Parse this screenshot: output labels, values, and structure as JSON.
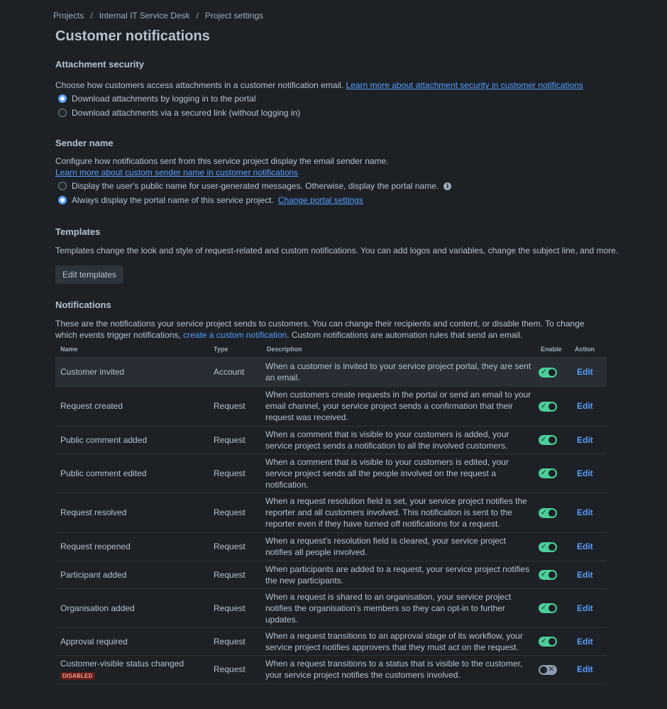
{
  "breadcrumb": [
    "Projects",
    "Internal IT Service Desk",
    "Project settings"
  ],
  "page_title": "Customer notifications",
  "attachment": {
    "title": "Attachment security",
    "description": "Choose how customers access attachments in a customer notification email.",
    "link": "Learn more about attachment security in customer notifications",
    "options": [
      {
        "label": "Download attachments by logging in to the portal",
        "checked": true
      },
      {
        "label": "Download attachments via a secured link (without logging in)",
        "checked": false
      }
    ]
  },
  "sender": {
    "title": "Sender name",
    "description": "Configure how notifications sent from this service project display the email sender name.",
    "link": "Learn more about custom sender name in customer notifications",
    "options": [
      {
        "label": "Display the user's public name for user-generated messages. Otherwise, display the portal name.",
        "checked": false,
        "icon": "info-icon"
      },
      {
        "label": "Always display the portal name of this service project.",
        "checked": true,
        "link": "Change portal settings"
      }
    ]
  },
  "templates": {
    "title": "Templates",
    "description": "Templates change the look and style of request-related and custom notifications. You can add logos and variables, change the subject line, and more.",
    "button": "Edit templates"
  },
  "notifications": {
    "title": "Notifications",
    "description_before": "These are the notifications your service project sends to customers. You can change their recipients and content, or disable them. To change which events trigger notifications, ",
    "description_link": "create a custom notification",
    "description_after": ". Custom notifications are automation rules that send an email.",
    "columns": [
      "Name",
      "Type",
      "Description",
      "Enable",
      "Action"
    ],
    "rows": [
      {
        "name": "Customer invited",
        "type": "Account",
        "description": "When a customer is invited to your service project portal, they are sent an email.",
        "enabled": true,
        "action": "Edit",
        "highlight": true,
        "h": 40
      },
      {
        "name": "Request created",
        "type": "Request",
        "description": "When customers create requests in the portal or send an email to your email channel, your service project sends a confirmation that their request was received.",
        "enabled": true,
        "action": "Edit",
        "h": 56
      },
      {
        "name": "Public comment added",
        "type": "Request",
        "description": "When a comment that is visible to your customers is added, your service project sends a notification to all the involved customers.",
        "enabled": true,
        "action": "Edit",
        "h": 39
      },
      {
        "name": "Public comment edited",
        "type": "Request",
        "description": "When a comment that is visible to your customers is edited, your service project sends all the people involved on the request a notification.",
        "enabled": true,
        "action": "Edit",
        "h": 39
      },
      {
        "name": "Request resolved",
        "type": "Request",
        "description": "When a request resolution field is set, your service project notifies the reporter and all customers involved. This notification is sent to the reporter even if they have turned off notifications for a request.",
        "enabled": true,
        "action": "Edit",
        "h": 56
      },
      {
        "name": "Request reopened",
        "type": "Request",
        "description": "When a request's resolution field is cleared, your service project notifies all people involved.",
        "enabled": true,
        "action": "Edit",
        "h": 40
      },
      {
        "name": "Participant added",
        "type": "Request",
        "description": "When participants are added to a request, your service project notifies the new participants.",
        "enabled": true,
        "action": "Edit",
        "h": 39
      },
      {
        "name": "Organisation added",
        "type": "Request",
        "description": "When a request is shared to an organisation, your service project notifies the organisation's members so they can opt-in to further updates.",
        "enabled": true,
        "action": "Edit",
        "h": 40
      },
      {
        "name": "Approval required",
        "type": "Request",
        "description": "When a request transitions to an approval stage of its workflow, your service project notifies approvers that they must act on the request.",
        "enabled": true,
        "action": "Edit",
        "h": 39
      },
      {
        "name": "Customer-visible status changed",
        "type": "Request",
        "description": "When a request transitions to a status that is visible to the customer, your service project notifies the customers involved.",
        "enabled": false,
        "badge": "DISABLED",
        "action": "Edit",
        "h": 40
      }
    ]
  }
}
